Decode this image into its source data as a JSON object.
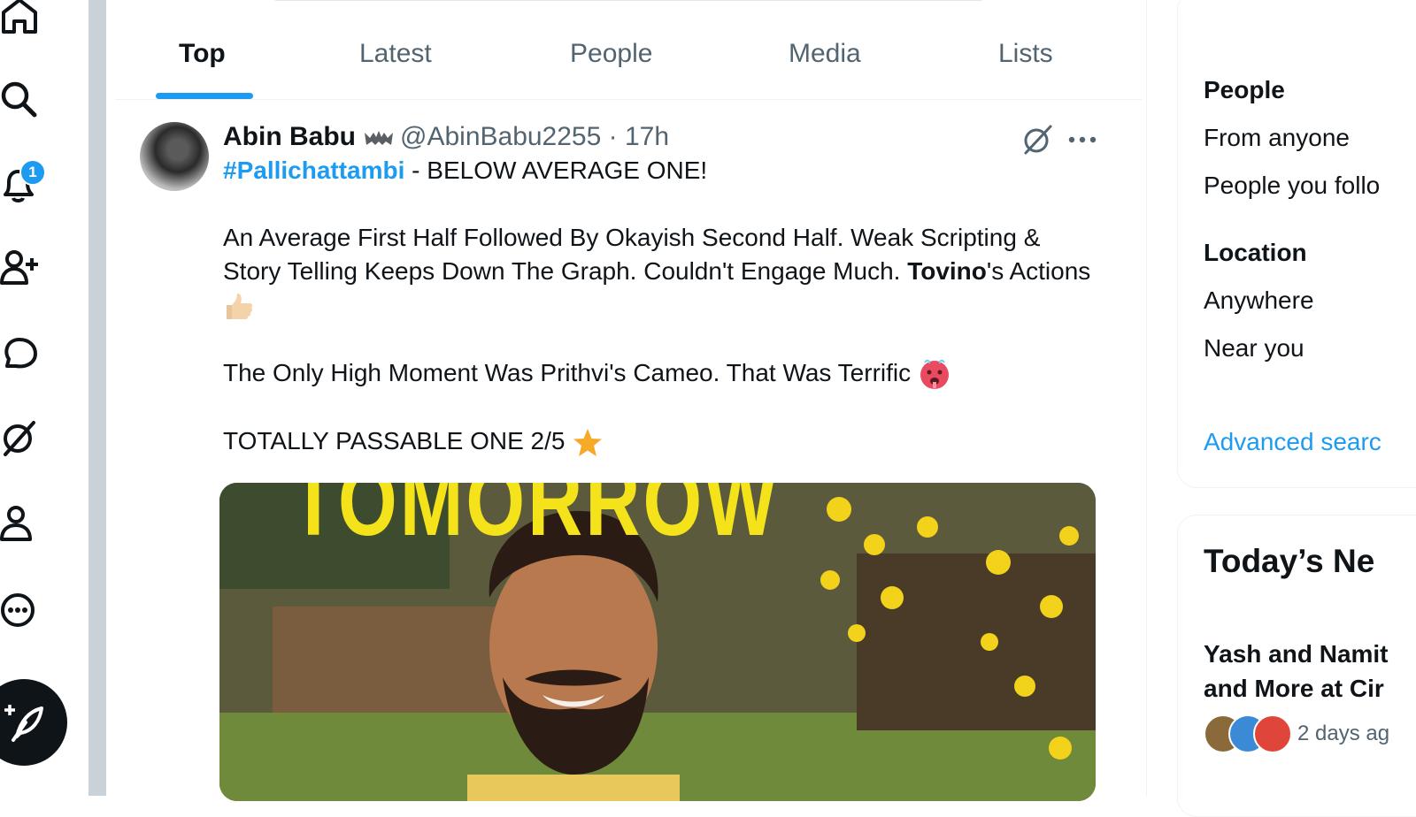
{
  "nav": {
    "notifications_badge": "1",
    "icons": [
      "home-icon",
      "search-icon",
      "notifications-icon",
      "follow-icon",
      "messages-icon",
      "grok-icon",
      "profile-icon",
      "more-icon",
      "compose-icon"
    ]
  },
  "tabs": [
    {
      "label": "Top",
      "active": true
    },
    {
      "label": "Latest",
      "active": false
    },
    {
      "label": "People",
      "active": false
    },
    {
      "label": "Media",
      "active": false
    },
    {
      "label": "Lists",
      "active": false
    }
  ],
  "tweet": {
    "author_name": "Abin Babu",
    "handle_time": "@AbinBabu2255 · 17h",
    "hashtag": "#Pallichattambi",
    "line1_rest": " - BELOW AVERAGE ONE!",
    "para2_a": "An Average First Half Followed By Okayish Second Half. Weak Scripting & Story Telling Keeps Down The Graph. Couldn't Engage Much. ",
    "para2_bold": "Tovino",
    "para2_b": "'s Actions",
    "para3": "The Only High Moment Was Prithvi's Cameo. That Was Terrific",
    "para4": "TOTALLY PASSABLE ONE 2/5",
    "media_text": "TOMORROW"
  },
  "sidebar": {
    "people_heading": "People",
    "from_anyone": "From anyone",
    "people_you_follow": "People you follo",
    "location_heading": "Location",
    "anywhere": "Anywhere",
    "near_you": "Near you",
    "advanced_search": "Advanced searc",
    "news_title": "Today’s Ne",
    "news_line1": "Yash and Namit",
    "news_line2": "and More at Cir",
    "news_time": "2 days ag"
  },
  "colors": {
    "accent": "#1d9bf0",
    "text": "#0f1419",
    "secondary": "#536471"
  }
}
